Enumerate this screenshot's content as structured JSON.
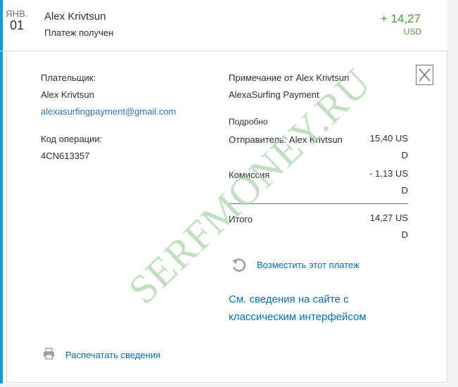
{
  "header": {
    "month": "ЯНВ.",
    "day": "01",
    "name": "Alex Krivtsun",
    "status": "Платеж получен",
    "amount": "+ 14,27",
    "currency": "USD"
  },
  "payer": {
    "label": "Плательщик:",
    "name": "Alex Krivtsun",
    "email": "alexasurfingpayment@gmail.com"
  },
  "operation": {
    "label": "Код операции:",
    "code": "4CN613357"
  },
  "note": {
    "label": "Примечание от Alex Krivtsun",
    "text": "AlexaSurfing Payment"
  },
  "details": {
    "label": "Подробно",
    "sender_label": "Отправитель: Alex Krivtsun",
    "sender_value": "15,40 USD",
    "fee_label": "Комиссия",
    "fee_value": "- 1,13 USD",
    "total_label": "Итого",
    "total_value": "14,27 USD"
  },
  "actions": {
    "refund": "Возместить этот платеж",
    "classic_line1": "См. сведения на сайте с",
    "classic_line2": "классическим интерфейсом",
    "print": "Распечатать сведения"
  },
  "watermark": "SERFMONEY.RU",
  "colors": {
    "accent": "#179bd7",
    "amount": "#4a9a3a",
    "link": "#0070ba"
  }
}
